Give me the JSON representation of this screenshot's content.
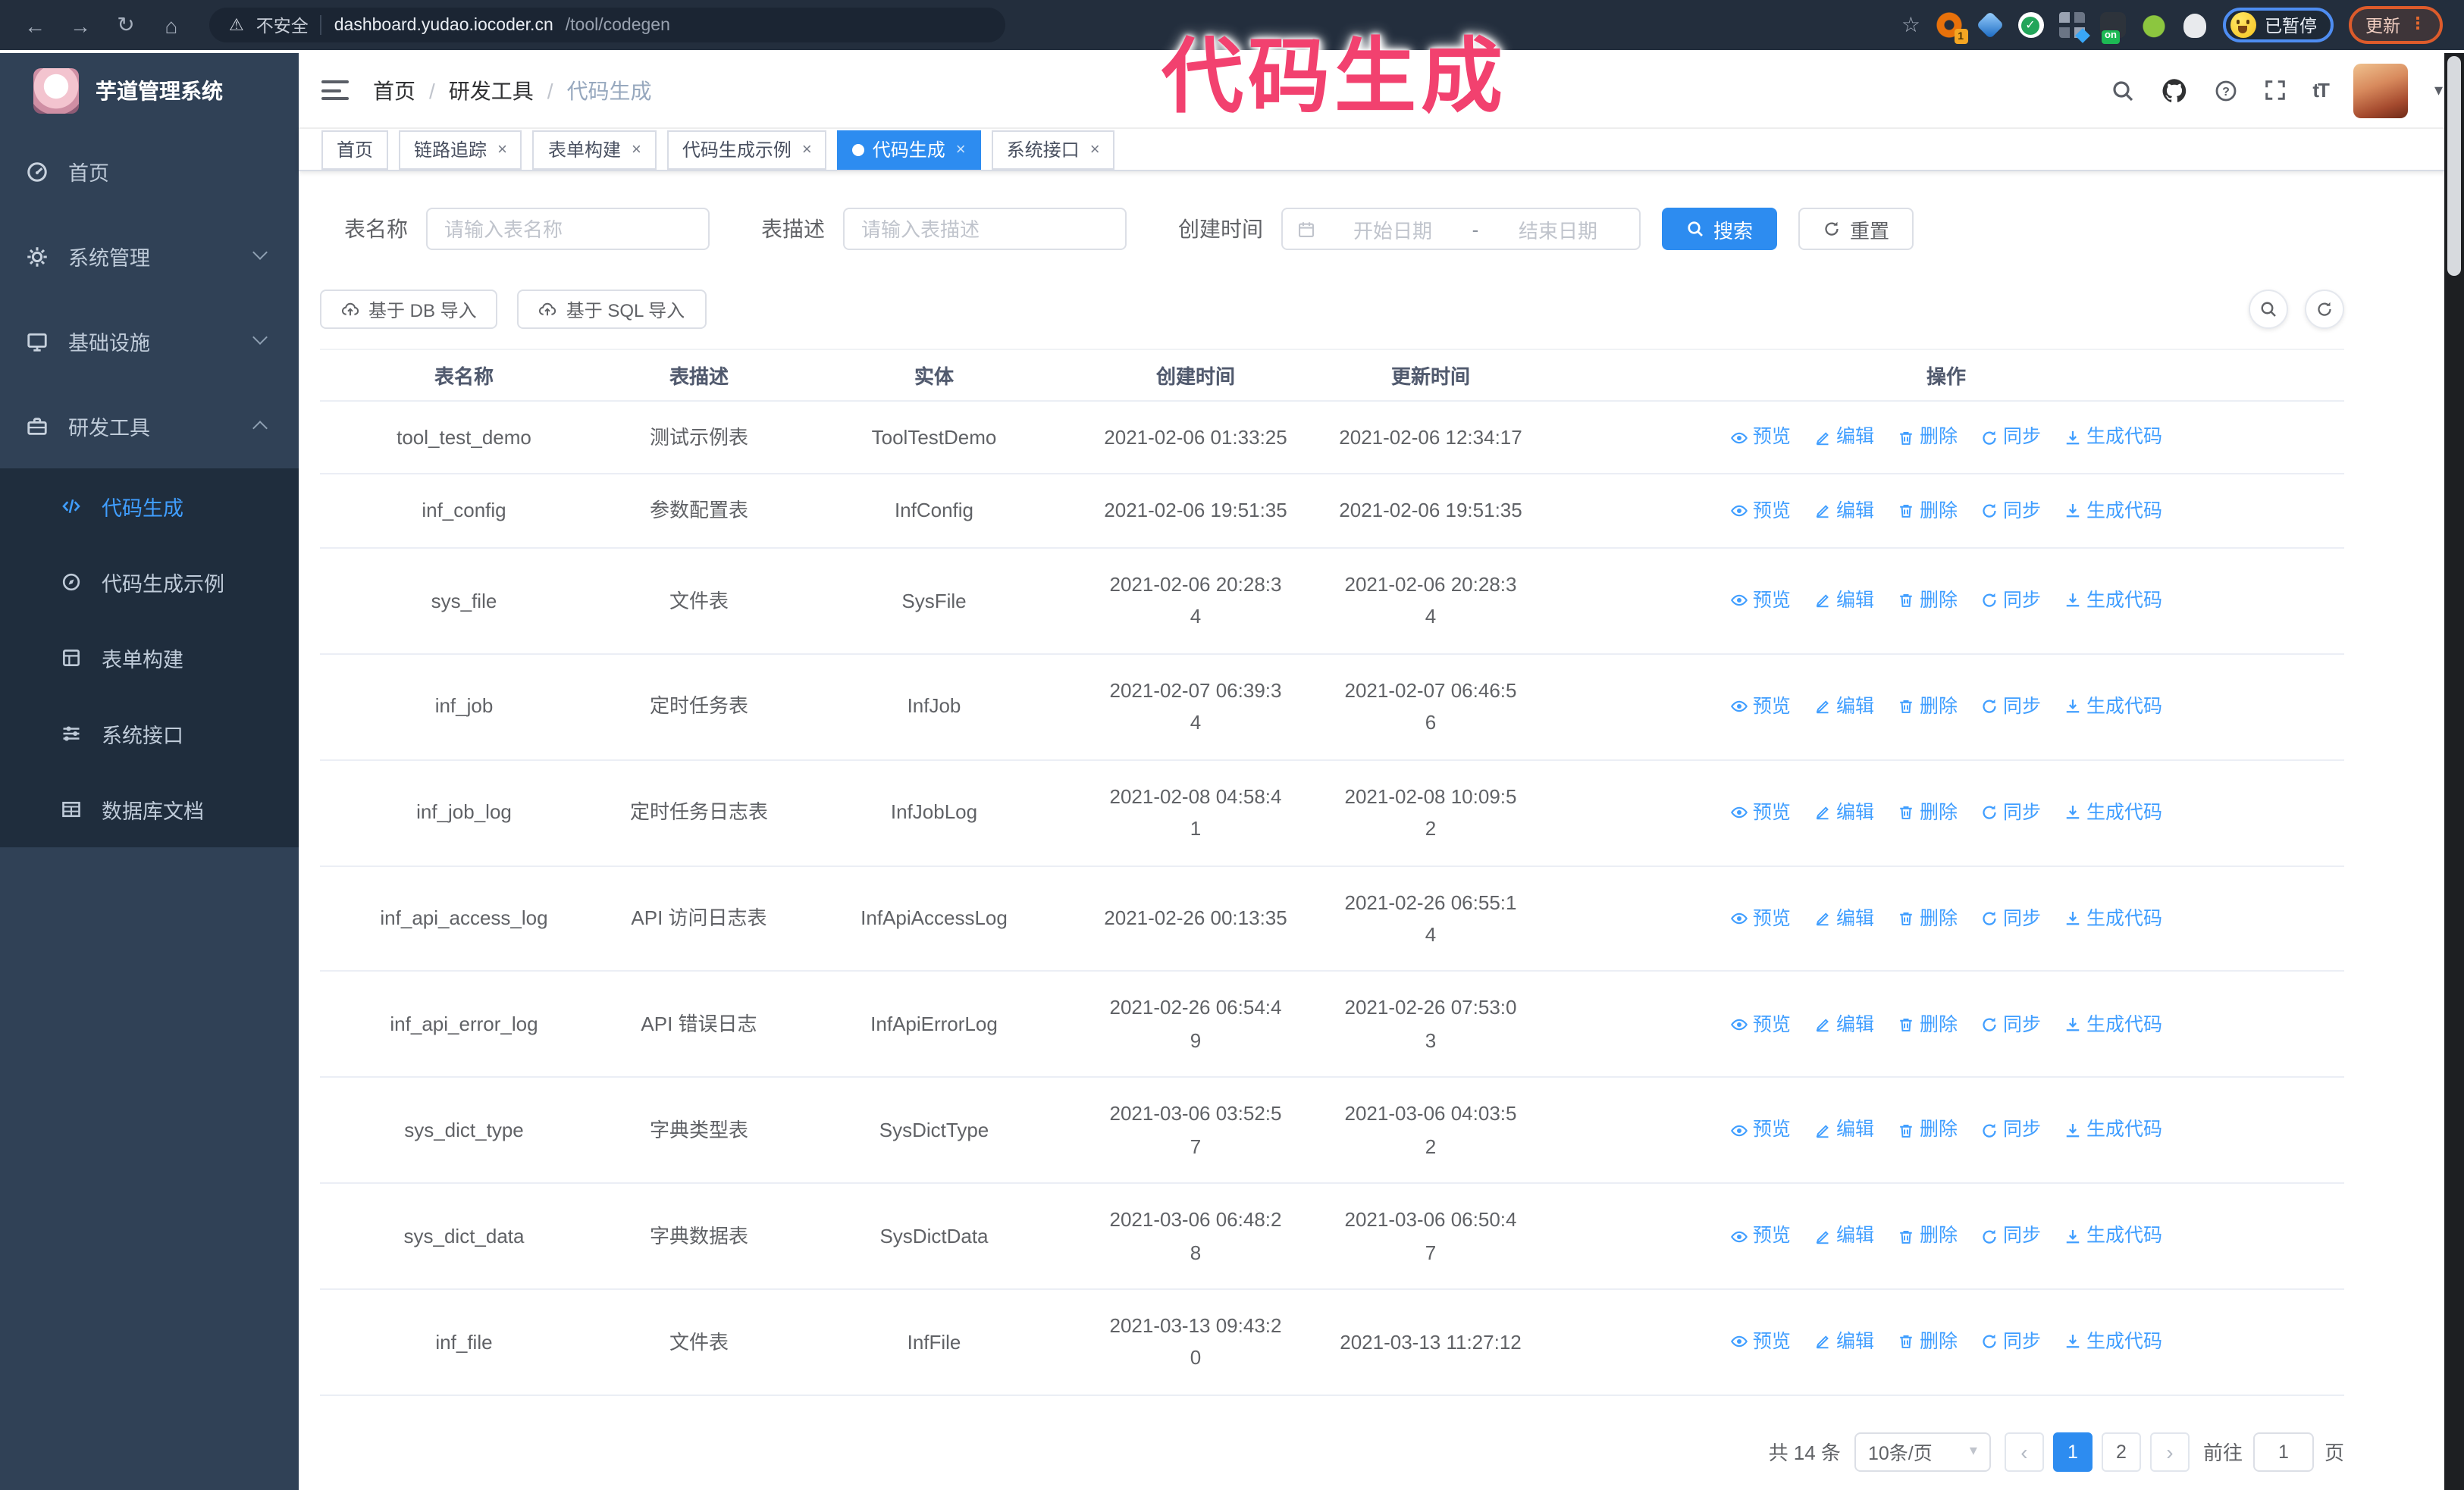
{
  "colors": {
    "primary": "#2d8cf0",
    "link": "#409eff",
    "annotation": "#f2416f",
    "sidebar_bg": "#304156",
    "submenu_bg": "#1f2d3d"
  },
  "annotation": {
    "text": "代码生成"
  },
  "browser": {
    "security_label": "不安全",
    "url_domain": "dashboard.yudao.iocoder.cn",
    "url_path": "/tool/codegen",
    "extension_badge": "1",
    "extension_on_badge": "on",
    "paused_badge": "已暂停",
    "update_button": "更新"
  },
  "app": {
    "title": "芋道管理系统"
  },
  "breadcrumb": {
    "items": [
      "首页",
      "研发工具",
      "代码生成"
    ]
  },
  "sidebar": {
    "items": [
      {
        "key": "home",
        "icon": "dashboard",
        "label": "首页"
      },
      {
        "key": "system-management",
        "icon": "gear",
        "label": "系统管理",
        "chevron": "down"
      },
      {
        "key": "infrastructure",
        "icon": "infra",
        "label": "基础设施",
        "chevron": "down"
      },
      {
        "key": "dev-tools",
        "icon": "tools",
        "label": "研发工具",
        "chevron": "up",
        "expanded": true,
        "submenu": [
          {
            "key": "codegen",
            "icon": "code",
            "label": "代码生成",
            "active": true
          },
          {
            "key": "codegen-example",
            "icon": "guide",
            "label": "代码生成示例"
          },
          {
            "key": "form-builder",
            "icon": "form",
            "label": "表单构建"
          },
          {
            "key": "system-api",
            "icon": "api",
            "label": "系统接口"
          },
          {
            "key": "db-doc",
            "icon": "dbdoc",
            "label": "数据库文档"
          }
        ]
      }
    ]
  },
  "tabs": [
    {
      "label": "首页",
      "closable": false,
      "active": false
    },
    {
      "label": "链路追踪",
      "closable": true,
      "active": false
    },
    {
      "label": "表单构建",
      "closable": true,
      "active": false
    },
    {
      "label": "代码生成示例",
      "closable": true,
      "active": false
    },
    {
      "label": "代码生成",
      "closable": true,
      "active": true
    },
    {
      "label": "系统接口",
      "closable": true,
      "active": false
    }
  ],
  "filters": {
    "table_name_label": "表名称",
    "table_name_placeholder": "请输入表名称",
    "table_desc_label": "表描述",
    "table_desc_placeholder": "请输入表描述",
    "create_time_label": "创建时间",
    "date_start_placeholder": "开始日期",
    "date_separator": "-",
    "date_end_placeholder": "结束日期",
    "search_label": "搜索",
    "reset_label": "重置"
  },
  "toolbar": {
    "import_db": "基于 DB 导入",
    "import_sql": "基于 SQL 导入"
  },
  "table": {
    "columns": [
      "表名称",
      "表描述",
      "实体",
      "创建时间",
      "更新时间",
      "操作"
    ],
    "actions": [
      {
        "key": "preview",
        "icon": "eye",
        "label": "预览"
      },
      {
        "key": "edit",
        "icon": "edit",
        "label": "编辑"
      },
      {
        "key": "delete",
        "icon": "delete",
        "label": "删除"
      },
      {
        "key": "sync",
        "icon": "sync",
        "label": "同步"
      },
      {
        "key": "generate-code",
        "icon": "download",
        "label": "生成代码"
      }
    ],
    "rows": [
      {
        "name": "tool_test_demo",
        "desc": "测试示例表",
        "entity": "ToolTestDemo",
        "created": "2021-02-06 01:33:25",
        "updated": "2021-02-06 12:34:17"
      },
      {
        "name": "inf_config",
        "desc": "参数配置表",
        "entity": "InfConfig",
        "created": "2021-02-06 19:51:35",
        "updated": "2021-02-06 19:51:35"
      },
      {
        "name": "sys_file",
        "desc": "文件表",
        "entity": "SysFile",
        "created": "2021-02-06 20:28:3\n4",
        "updated": "2021-02-06 20:28:3\n4"
      },
      {
        "name": "inf_job",
        "desc": "定时任务表",
        "entity": "InfJob",
        "created": "2021-02-07 06:39:3\n4",
        "updated": "2021-02-07 06:46:5\n6"
      },
      {
        "name": "inf_job_log",
        "desc": "定时任务日志表",
        "entity": "InfJobLog",
        "created": "2021-02-08 04:58:4\n1",
        "updated": "2021-02-08 10:09:5\n2"
      },
      {
        "name": "inf_api_access_log",
        "desc": "API 访问日志表",
        "entity": "InfApiAccessLog",
        "created": "2021-02-26 00:13:35",
        "updated": "2021-02-26 06:55:1\n4"
      },
      {
        "name": "inf_api_error_log",
        "desc": "API 错误日志",
        "entity": "InfApiErrorLog",
        "created": "2021-02-26 06:54:4\n9",
        "updated": "2021-02-26 07:53:0\n3"
      },
      {
        "name": "sys_dict_type",
        "desc": "字典类型表",
        "entity": "SysDictType",
        "created": "2021-03-06 03:52:5\n7",
        "updated": "2021-03-06 04:03:5\n2"
      },
      {
        "name": "sys_dict_data",
        "desc": "字典数据表",
        "entity": "SysDictData",
        "created": "2021-03-06 06:48:2\n8",
        "updated": "2021-03-06 06:50:4\n7"
      },
      {
        "name": "inf_file",
        "desc": "文件表",
        "entity": "InfFile",
        "created": "2021-03-13 09:43:2\n0",
        "updated": "2021-03-13 11:27:12"
      }
    ]
  },
  "pagination": {
    "total": "共 14 条",
    "page_size": "10条/页",
    "pages": [
      {
        "label": "1",
        "active": true
      },
      {
        "label": "2",
        "active": false
      }
    ],
    "goto_label": "前往",
    "goto_value": "1",
    "goto_suffix": "页"
  }
}
